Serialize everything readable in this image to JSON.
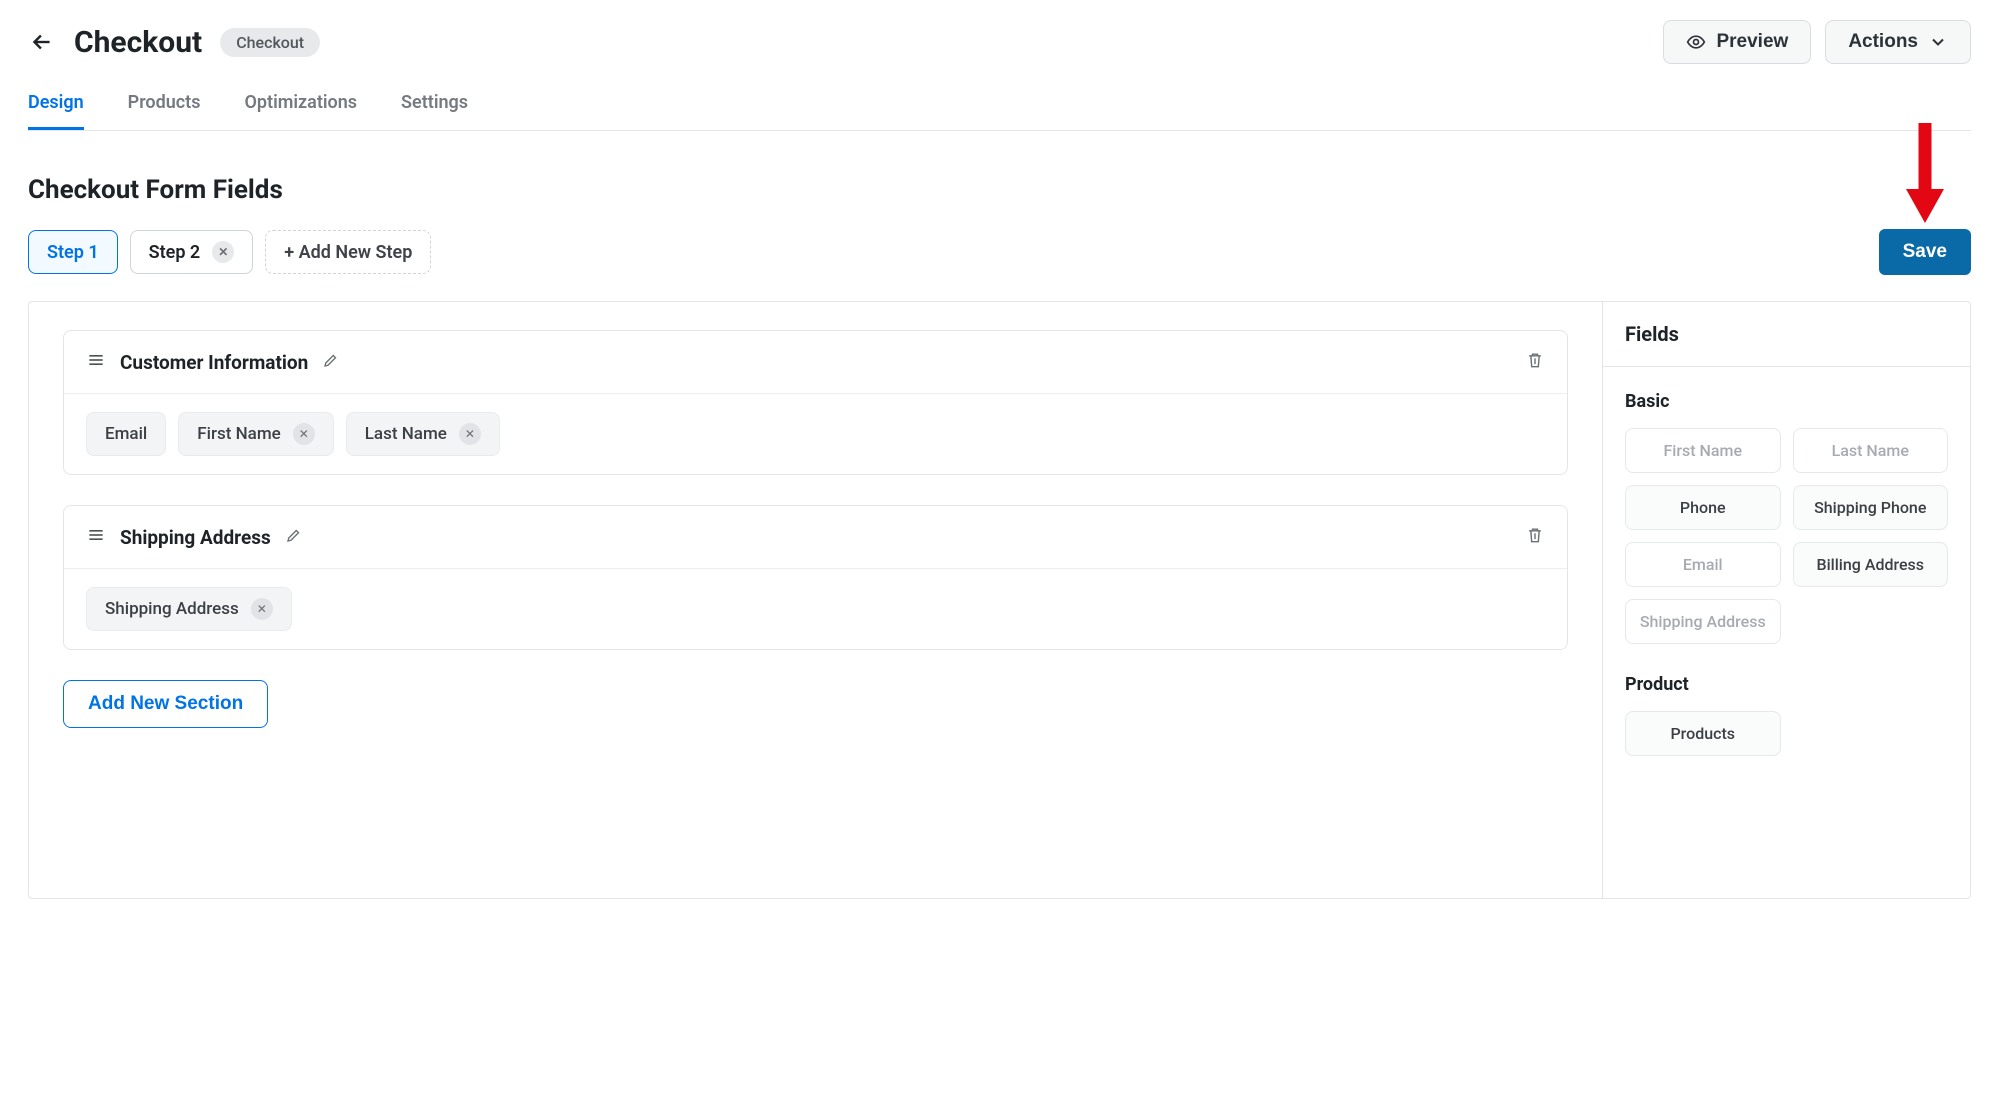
{
  "header": {
    "title": "Checkout",
    "badge": "Checkout",
    "preview_label": "Preview",
    "actions_label": "Actions"
  },
  "tabs": {
    "items": [
      {
        "label": "Design",
        "active": true
      },
      {
        "label": "Products",
        "active": false
      },
      {
        "label": "Optimizations",
        "active": false
      },
      {
        "label": "Settings",
        "active": false
      }
    ]
  },
  "section_title": "Checkout Form Fields",
  "steps": {
    "items": [
      {
        "label": "Step 1",
        "active": true,
        "closable": false
      },
      {
        "label": "Step 2",
        "active": false,
        "closable": true
      }
    ],
    "add_label": "+ Add New Step"
  },
  "save_label": "Save",
  "sections": [
    {
      "title": "Customer Information",
      "fields": [
        {
          "label": "Email",
          "removable": false
        },
        {
          "label": "First Name",
          "removable": true
        },
        {
          "label": "Last Name",
          "removable": true
        }
      ]
    },
    {
      "title": "Shipping Address",
      "fields": [
        {
          "label": "Shipping Address",
          "removable": true
        }
      ]
    }
  ],
  "add_section_label": "Add New Section",
  "sidebar": {
    "title": "Fields",
    "groups": [
      {
        "title": "Basic",
        "items": [
          {
            "label": "First Name",
            "muted": true
          },
          {
            "label": "Last Name",
            "muted": true
          },
          {
            "label": "Phone",
            "muted": false
          },
          {
            "label": "Shipping Phone",
            "muted": false
          },
          {
            "label": "Email",
            "muted": true
          },
          {
            "label": "Billing Address",
            "muted": false
          },
          {
            "label": "Shipping Address",
            "muted": true
          }
        ]
      },
      {
        "title": "Product",
        "items": [
          {
            "label": "Products",
            "muted": false
          }
        ]
      }
    ]
  }
}
